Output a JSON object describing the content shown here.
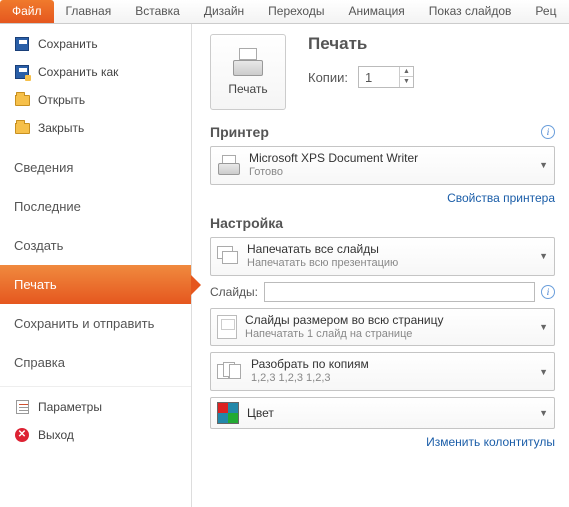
{
  "ribbon": {
    "tabs": [
      "Файл",
      "Главная",
      "Вставка",
      "Дизайн",
      "Переходы",
      "Анимация",
      "Показ слайдов",
      "Рец"
    ]
  },
  "sidebar": {
    "quick": {
      "save": "Сохранить",
      "save_as": "Сохранить как",
      "open": "Открыть",
      "close": "Закрыть"
    },
    "main": {
      "info": "Сведения",
      "recent": "Последние",
      "new": "Создать",
      "print": "Печать",
      "share": "Сохранить и отправить",
      "help": "Справка"
    },
    "bottom": {
      "options": "Параметры",
      "exit": "Выход"
    }
  },
  "print": {
    "heading": "Печать",
    "button": "Печать",
    "copies_label": "Копии:",
    "copies_value": "1"
  },
  "printer": {
    "heading": "Принтер",
    "name": "Microsoft XPS Document Writer",
    "status": "Готово",
    "props_link": "Свойства принтера"
  },
  "settings": {
    "heading": "Настройка",
    "what": {
      "t1": "Напечатать все слайды",
      "t2": "Напечатать всю презентацию"
    },
    "slides_label": "Слайды:",
    "slides_value": "",
    "layout": {
      "t1": "Слайды размером во всю страницу",
      "t2": "Напечатать 1 слайд на странице"
    },
    "collate": {
      "t1": "Разобрать по копиям",
      "t2": "1,2,3   1,2,3   1,2,3"
    },
    "color": {
      "t1": "Цвет"
    },
    "footer_link": "Изменить колонтитулы"
  }
}
